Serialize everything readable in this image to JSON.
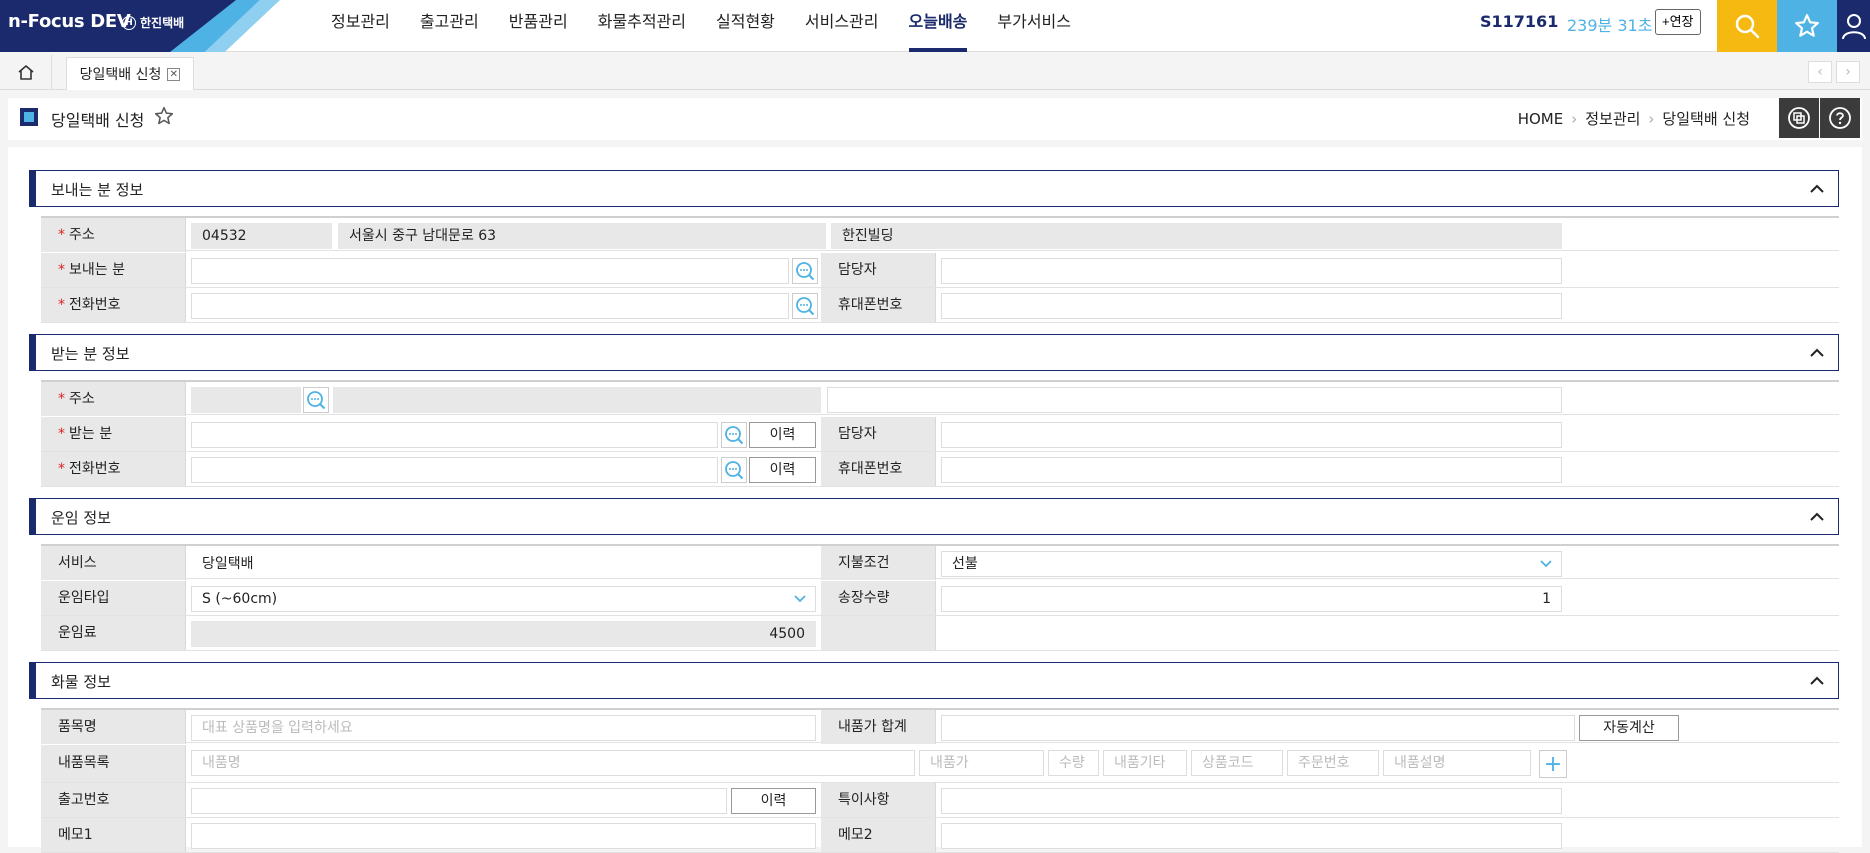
{
  "header": {
    "logo_text": "n-Focus DEV",
    "logo_sub": "한진택배",
    "logo_mark": "H",
    "nav": [
      "정보관리",
      "출고관리",
      "반품관리",
      "화물추적관리",
      "실적현황",
      "서비스관리",
      "오늘배송",
      "부가서비스"
    ],
    "active_nav": "오늘배송",
    "user_id": "S117161",
    "timer": "239분 31초",
    "extend_label": "+연장"
  },
  "tabs": {
    "open_tab": "당일택배 신청",
    "close_glyph": "✕",
    "prev_glyph": "‹",
    "next_glyph": "›"
  },
  "page": {
    "title": "당일택배 신청",
    "breadcrumb": [
      "HOME",
      "정보관리",
      "당일택배 신청"
    ],
    "breadcrumb_sep": "›"
  },
  "colors": {
    "navy": "#1a2a6c",
    "sky": "#4fb2e4",
    "yellow": "#f6b912",
    "required": "#e02020"
  },
  "sender": {
    "title": "보내는 분 정보",
    "address_label": "주소",
    "zip": "04532",
    "address": "서울시 중구 남대문로 63",
    "address_detail": "한진빌딩",
    "name_label": "보내는 분",
    "manager_label": "담당자",
    "phone_label": "전화번호",
    "mobile_label": "휴대폰번호"
  },
  "receiver": {
    "title": "받는 분 정보",
    "address_label": "주소",
    "name_label": "받는 분",
    "manager_label": "담당자",
    "phone_label": "전화번호",
    "mobile_label": "휴대폰번호",
    "history_label": "이력"
  },
  "freight": {
    "title": "운임 정보",
    "service_label": "서비스",
    "service_value": "당일택배",
    "payment_label": "지불조건",
    "payment_value": "선불",
    "type_label": "운임타입",
    "type_value": "S (~60cm)",
    "count_label": "송장수량",
    "count_value": "1",
    "fee_label": "운임료",
    "fee_value": "4500"
  },
  "cargo": {
    "title": "화물 정보",
    "item_label": "품목명",
    "item_placeholder": "대표 상품명을 입력하세요",
    "total_label": "내품가 합계",
    "auto_calc_label": "자동계산",
    "list_label": "내품목록",
    "list_placeholders": [
      "내품명",
      "내품가",
      "수량",
      "내품기타",
      "상품코드",
      "주문번호",
      "내품설명"
    ],
    "add_glyph": "+",
    "release_label": "출고번호",
    "history_label": "이력",
    "special_label": "특이사항",
    "memo1_label": "메모1",
    "memo2_label": "메모2"
  }
}
